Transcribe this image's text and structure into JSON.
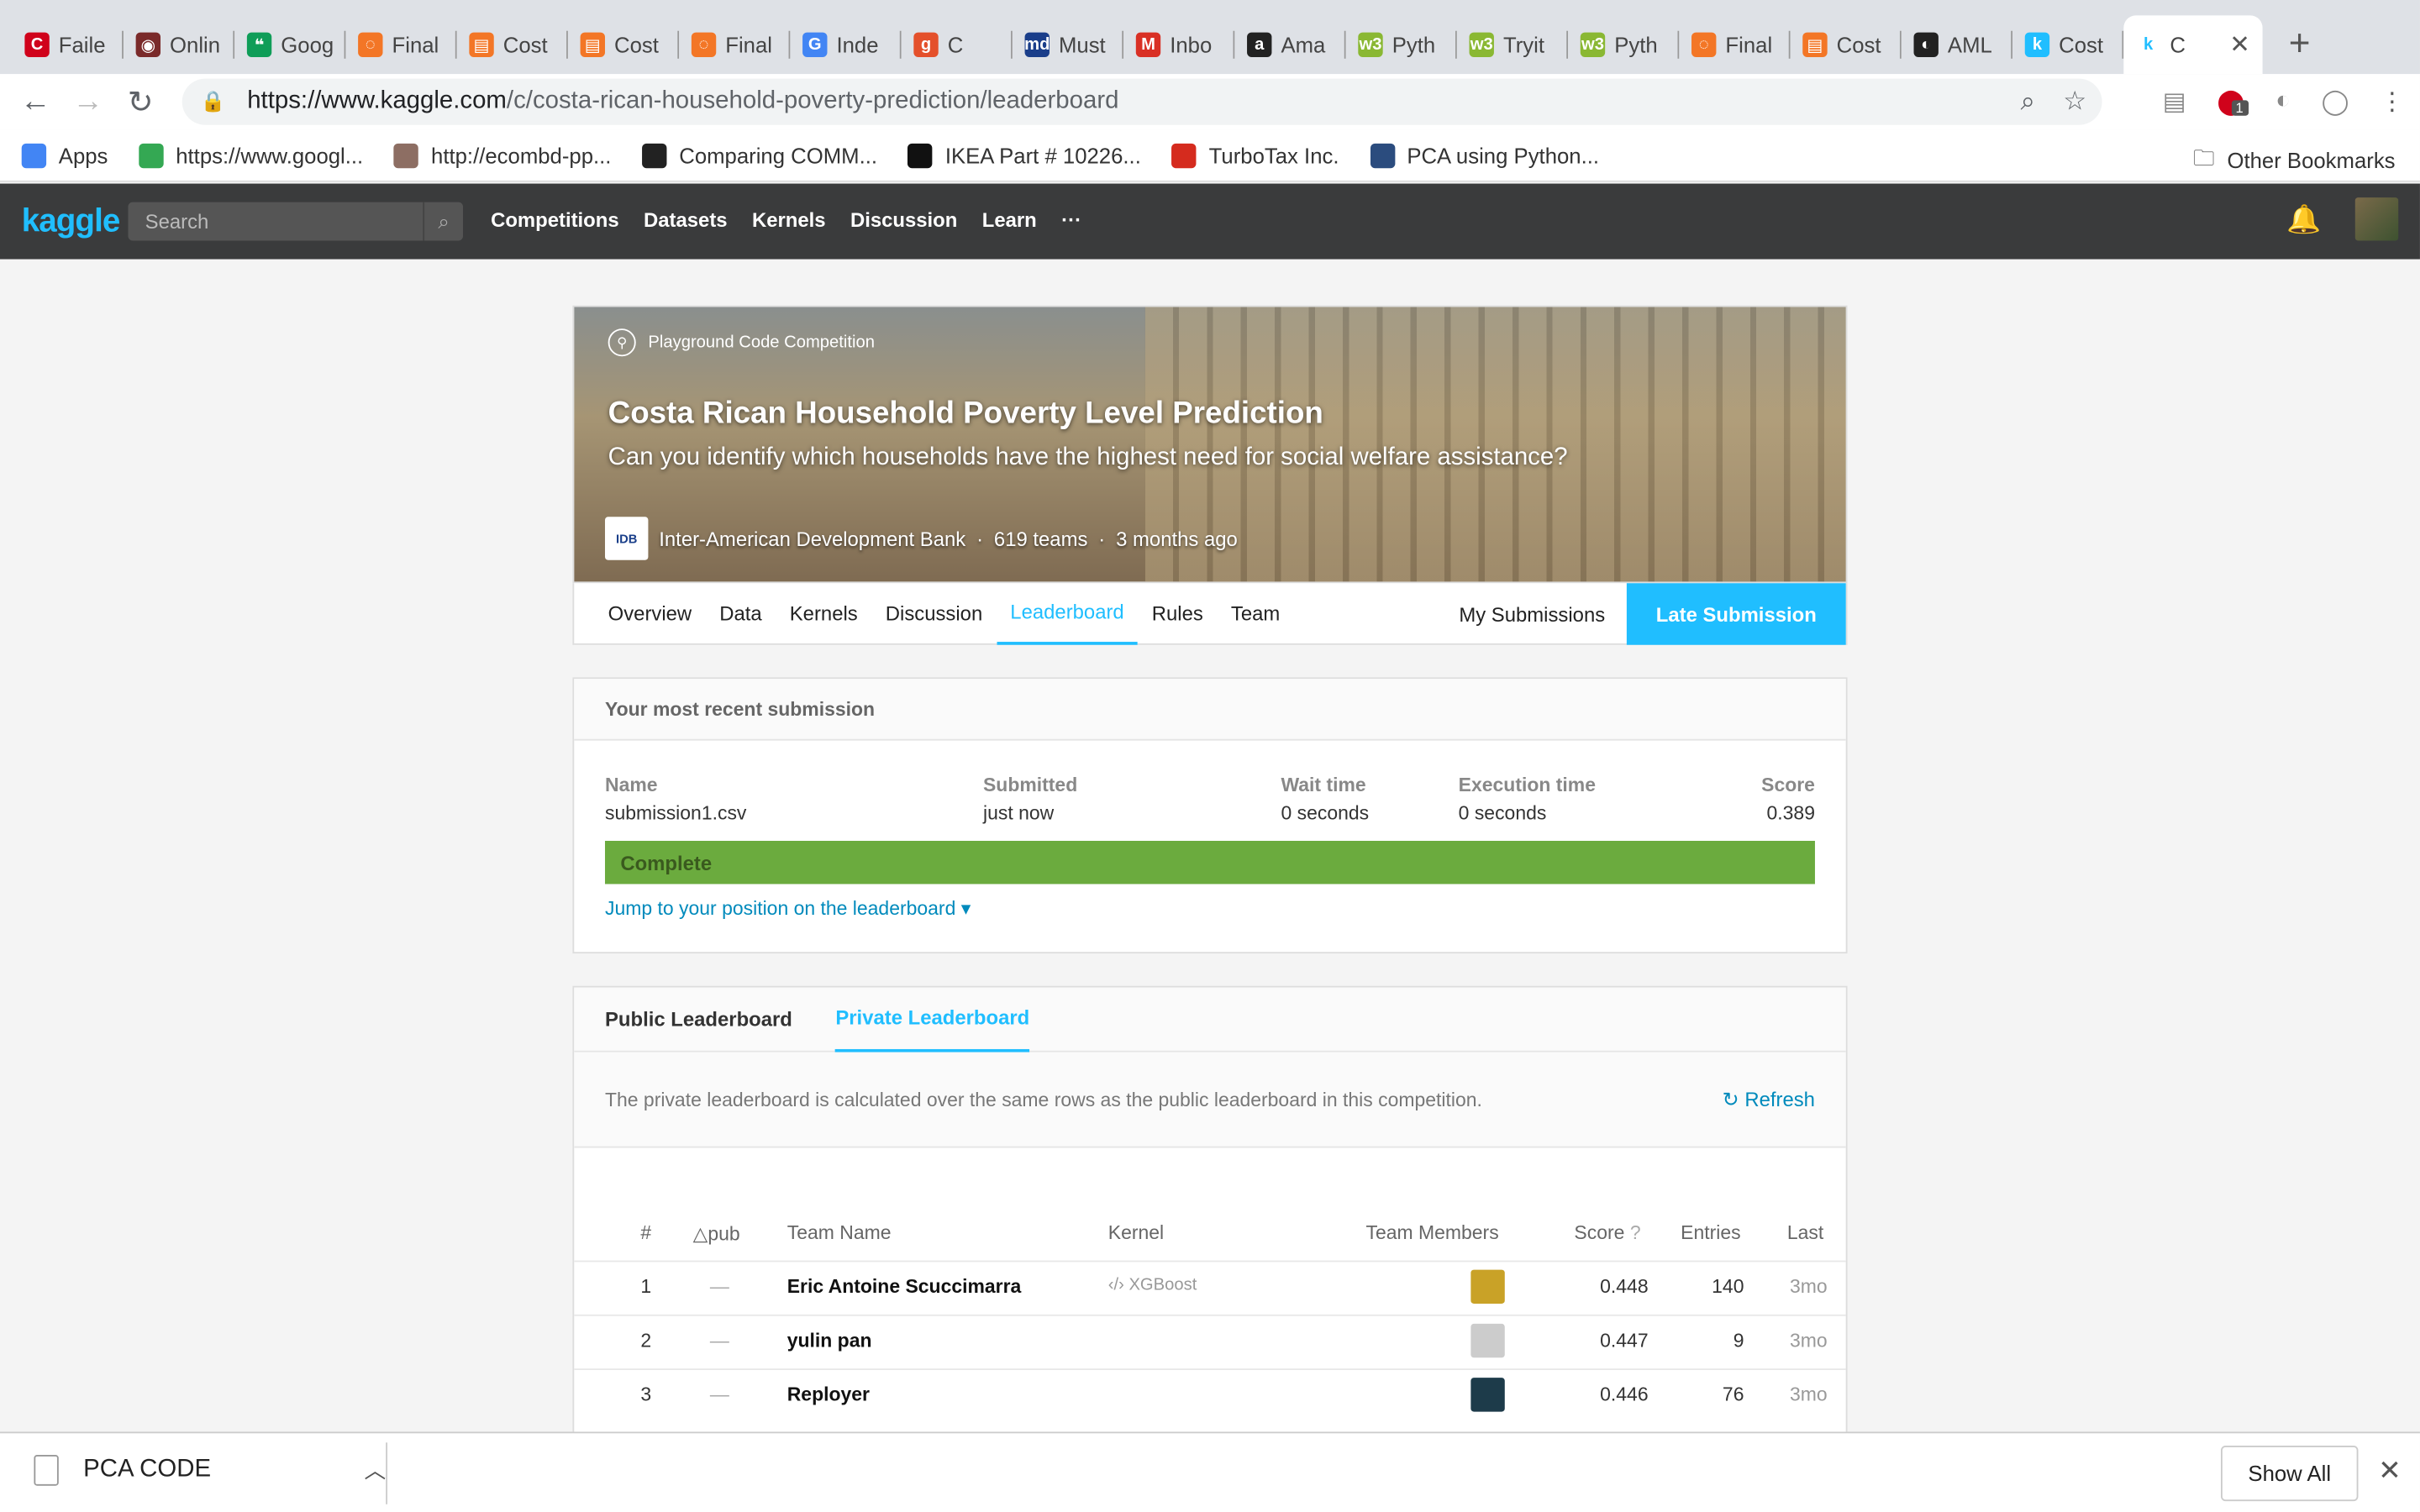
{
  "browser": {
    "tabs": [
      {
        "label": "Faile",
        "color": "#d0021b",
        "glyph": "C"
      },
      {
        "label": "Onlin",
        "color": "#7a2a2a",
        "glyph": "◉"
      },
      {
        "label": "Goog",
        "color": "#0f9d58",
        "glyph": "❝"
      },
      {
        "label": "Final",
        "color": "#f37626",
        "glyph": "◌"
      },
      {
        "label": "Cost",
        "color": "#f37626",
        "glyph": "▤"
      },
      {
        "label": "Cost",
        "color": "#f37626",
        "glyph": "▤"
      },
      {
        "label": "Final",
        "color": "#f37626",
        "glyph": "◌"
      },
      {
        "label": "Inde",
        "color": "#4285f4",
        "glyph": "G"
      },
      {
        "label": "C",
        "color": "#e4502b",
        "glyph": "g"
      },
      {
        "label": "Must",
        "color": "#1a3e8a",
        "glyph": "md"
      },
      {
        "label": "Inbo",
        "color": "#d93025",
        "glyph": "M"
      },
      {
        "label": "Ama",
        "color": "#222222",
        "glyph": "a"
      },
      {
        "label": "Pyth",
        "color": "#8ab833",
        "glyph": "w3"
      },
      {
        "label": "Tryit",
        "color": "#8ab833",
        "glyph": "w3"
      },
      {
        "label": "Pyth",
        "color": "#8ab833",
        "glyph": "w3"
      },
      {
        "label": "Final",
        "color": "#f37626",
        "glyph": "◌"
      },
      {
        "label": "Cost",
        "color": "#f37626",
        "glyph": "▤"
      },
      {
        "label": "AML",
        "color": "#222222",
        "glyph": "◐"
      },
      {
        "label": "Cost",
        "color": "#20beff",
        "glyph": "k"
      }
    ],
    "active_tab": {
      "label": "C",
      "glyph": "k"
    },
    "url_host": "https://www.kaggle.com",
    "url_path": "/c/costa-rican-household-poverty-prediction/leaderboard",
    "bookmarks": [
      {
        "label": "Apps",
        "color": "#4285f4"
      },
      {
        "label": "https://www.googl...",
        "color": "#34a853"
      },
      {
        "label": "http://ecombd-pp...",
        "color": "#8d6e63"
      },
      {
        "label": "Comparing COMM...",
        "color": "#222222"
      },
      {
        "label": "IKEA Part # 10226...",
        "color": "#111111"
      },
      {
        "label": "TurboTax Inc.",
        "color": "#d52b1e"
      },
      {
        "label": "PCA using Python...",
        "color": "#2b4c7e"
      }
    ],
    "other_bookmarks": "Other Bookmarks",
    "extension_badge": "1"
  },
  "kaggle_nav": {
    "logo": "kaggle",
    "search_placeholder": "Search",
    "links": [
      "Competitions",
      "Datasets",
      "Kernels",
      "Discussion",
      "Learn"
    ],
    "more": "···"
  },
  "competition": {
    "type": "Playground Code Competition",
    "title": "Costa Rican Household Poverty Level Prediction",
    "subtitle": "Can you identify which households have the highest need for social welfare assistance?",
    "host_logo": "IDB",
    "host": "Inter-American Development Bank",
    "teams": "619 teams",
    "ago": "3 months ago",
    "tabs": [
      "Overview",
      "Data",
      "Kernels",
      "Discussion",
      "Leaderboard",
      "Rules",
      "Team"
    ],
    "active_tab": "Leaderboard",
    "my_submissions": "My Submissions",
    "late_submission": "Late Submission"
  },
  "recent_submission": {
    "header": "Your most recent submission",
    "name_label": "Name",
    "name": "submission1.csv",
    "submitted_label": "Submitted",
    "submitted": "just now",
    "wait_label": "Wait time",
    "wait": "0 seconds",
    "exec_label": "Execution time",
    "exec": "0 seconds",
    "score_label": "Score",
    "score": "0.389",
    "status": "Complete",
    "jump": "Jump to your position on the leaderboard ▾"
  },
  "leaderboard": {
    "tabs": [
      "Public Leaderboard",
      "Private Leaderboard"
    ],
    "active_tab": "Private Leaderboard",
    "note": "The private leaderboard is calculated over the same rows as the public leaderboard in this competition.",
    "refresh": "Refresh",
    "columns": {
      "rank": "#",
      "delta": "△pub",
      "team": "Team Name",
      "kernel": "Kernel",
      "members": "Team Members",
      "score": "Score",
      "entries": "Entries",
      "last": "Last"
    },
    "rows": [
      {
        "rank": "1",
        "delta": "—",
        "team": "Eric Antoine Scuccimarra",
        "kernel": "XGBoost",
        "score": "0.448",
        "entries": "140",
        "last": "3mo",
        "avatar": "#c9a227"
      },
      {
        "rank": "2",
        "delta": "—",
        "team": "yulin pan",
        "kernel": "",
        "score": "0.447",
        "entries": "9",
        "last": "3mo",
        "avatar": "#cccccc"
      },
      {
        "rank": "3",
        "delta": "—",
        "team": "Reployer",
        "kernel": "",
        "score": "0.446",
        "entries": "76",
        "last": "3mo",
        "avatar": "#1d3b4a"
      }
    ]
  },
  "downloads": {
    "file": "PCA CODE",
    "show_all": "Show All"
  }
}
